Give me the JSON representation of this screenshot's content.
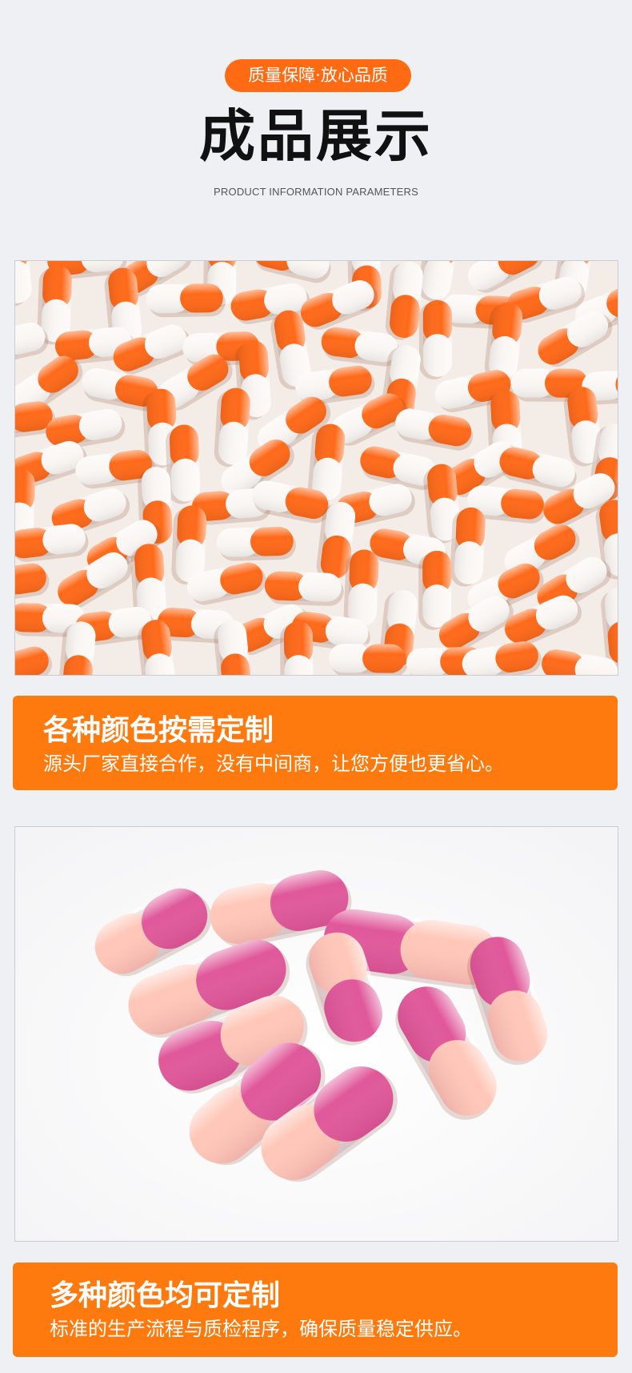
{
  "header": {
    "badge": "质量保障·放心品质",
    "title": "成品展示",
    "subtitle": "PRODUCT INFORMATION PARAMETERS"
  },
  "sections": [
    {
      "image_icon": "orange-white-capsules-photo",
      "heading": "各种颜色按需定制",
      "text": "源头厂家直接合作，没有中间商，让您方便也更省心。"
    },
    {
      "image_icon": "pink-capsules-photo",
      "heading": "多种颜色均可定制",
      "text": "标准的生产流程与质检程序，确保质量稳定供应。"
    }
  ],
  "colors": {
    "accent": "#ff7a0e",
    "badge": "#ff6a12",
    "background": "#eef0f4",
    "capsule_orange": "#ff6a1a",
    "capsule_white": "#fbf7f4",
    "capsule_pink": "#e0589a",
    "capsule_peach": "#ffc7b8"
  }
}
